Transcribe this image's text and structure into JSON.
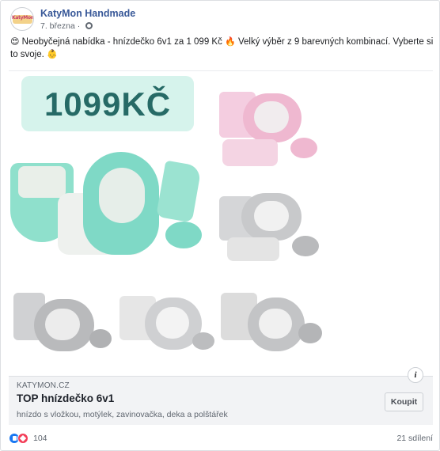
{
  "post": {
    "page_name": "KatyMon Handmade",
    "date": "7. března",
    "avatar_text": "KatyMon",
    "text_parts": [
      "Neobyčejná nabídka - hnízdečko 6v1 za 1 099 Kč",
      "Velký výběr z 9 barevných kombinací. Vyberte si to svoje."
    ],
    "icons": [
      "heart-eyes-emoji",
      "fire-emoji",
      "baby-emoji",
      "globe-icon"
    ]
  },
  "photo": {
    "price": "1099KČ",
    "colors": {
      "badge_bg": "#d6f3ec",
      "price_text": "#266a66",
      "mint": "#7fd9c6",
      "pink": "#f2c4db",
      "grey": "#c8c9cb"
    }
  },
  "link": {
    "domain": "KATYMON.CZ",
    "title": "TOP hnízdečko 6v1",
    "description": "hnízdo s vložkou, motýlek, zavinovačka, deka a polštářek",
    "button": "Koupit",
    "info": "i"
  },
  "footer": {
    "reactions": "104",
    "shares": "21 sdílení"
  }
}
